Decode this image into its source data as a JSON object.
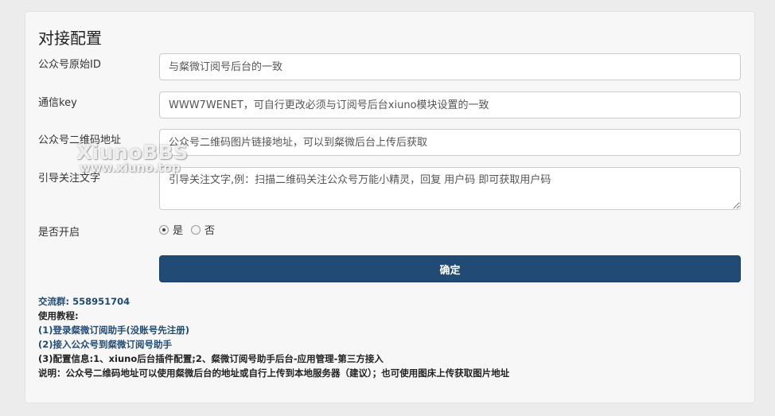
{
  "form": {
    "title": "对接配置",
    "fields": [
      {
        "label": "公众号原始ID",
        "placeholder": "与粲微订阅号后台的一致"
      },
      {
        "label": "通信key",
        "placeholder": "WWW7WENET，可自行更改必须与订阅号后台xiuno模块设置的一致"
      },
      {
        "label": "公众号二维码地址",
        "placeholder": "公众号二维码图片链接地址，可以到粲微后台上传后获取"
      },
      {
        "label": "引导关注文字",
        "placeholder": "引导关注文字,例：扫描二维码关注公众号万能小精灵，回复 用户码 即可获取用户码"
      }
    ],
    "enable": {
      "label": "是否开启",
      "options": [
        "是",
        "否"
      ],
      "selected": "是"
    },
    "submit_label": "确定"
  },
  "info": {
    "group_label": "交流群:",
    "group_number": "558951704",
    "tutorial_label": "使用教程:",
    "step1": "(1)登录粲微订阅助手(没账号先注册)",
    "step2": "(2)接入公众号到粲微订阅号助手",
    "step3": "(3)配置信息:1、xiuno后台插件配置;2、粲微订阅号助手后台-应用管理-第三方接入",
    "note": "说明：公众号二维码地址可以使用粲微后台的地址或自行上传到本地服务器（建议）；也可使用图床上传获取图片地址"
  },
  "watermark": {
    "brand": "XiunoBBS",
    "url": "www.xiuno.top"
  },
  "colors": {
    "primary": "#214a75",
    "background": "#ececec",
    "card": "#f7f7f7"
  }
}
